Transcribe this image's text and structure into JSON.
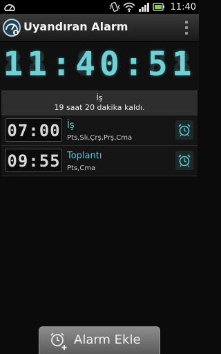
{
  "status_bar": {
    "time": "11:40",
    "icons": [
      "speedometer-icon",
      "vibrate-icon",
      "wifi-icon",
      "signal-icon",
      "battery-icon"
    ]
  },
  "app_bar": {
    "title": "Uyandıran Alarm",
    "menu_icon": "overflow-menu-icon"
  },
  "clock": {
    "time": "11:40:51",
    "ghost": "88:88:88",
    "color": "#6fd0d6"
  },
  "next_alarm": {
    "name": "İş",
    "remaining": "19 saat 20 dakika  kaldı."
  },
  "alarms": [
    {
      "time": "07:00",
      "title": "İş",
      "days": "Pts,Slı,Çrş,Prş,Cma",
      "icon": "alarm-clock-icon"
    },
    {
      "time": "09:55",
      "title": "Toplantı",
      "days": "Pts,Cma",
      "icon": "alarm-clock-icon"
    }
  ],
  "add_button": {
    "label": "Alarm Ekle",
    "icon": "add-alarm-icon"
  }
}
